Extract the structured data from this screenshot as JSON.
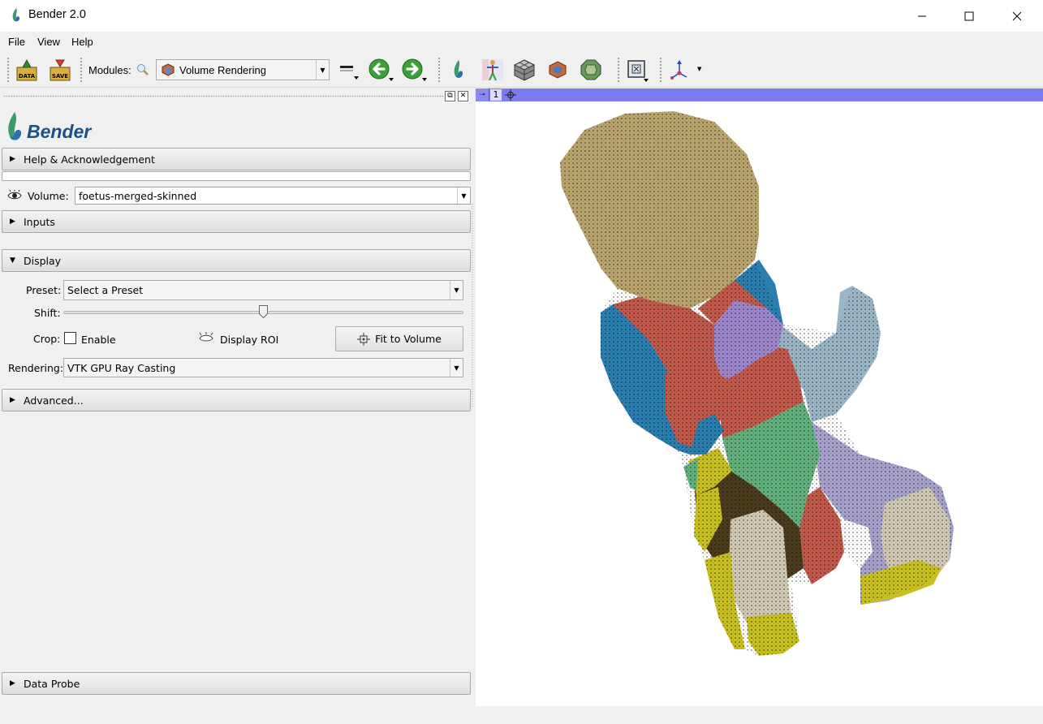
{
  "window": {
    "title": "Bender 2.0",
    "minimize_icon": "minimize-icon",
    "maximize_icon": "maximize-icon",
    "close_icon": "close-icon"
  },
  "menu": [
    "File",
    "View",
    "Help"
  ],
  "toolbar": {
    "load_data_label": "DATA",
    "save_label": "SAVE",
    "modules_label": "Modules:",
    "module_selected": "Volume Rendering",
    "icons": [
      "load-data-icon",
      "save-icon",
      "module-search-icon",
      "module-list-icon",
      "back-arrow-icon",
      "forward-arrow-icon",
      "bender-icon",
      "armature-icon",
      "model-grid-icon",
      "volume-cube-icon",
      "merge-labels-icon",
      "layout-icon",
      "axes-icon"
    ]
  },
  "panel": {
    "logo_text": "Bender",
    "help_section": "Help & Acknowledgement",
    "volume_label": "Volume:",
    "volume_value": "foetus-merged-skinned",
    "inputs_section": "Inputs",
    "display_section": "Display",
    "preset_label": "Preset:",
    "preset_value": "Select a Preset",
    "shift_label": "Shift:",
    "shift_level": 0.5,
    "crop_label": "Crop:",
    "enable_label": "Enable",
    "enable_checked": false,
    "display_roi_label": "Display ROI",
    "fit_button": "Fit to Volume",
    "rendering_label": "Rendering:",
    "rendering_value": "VTK GPU Ray Casting",
    "advanced_section": "Advanced...",
    "data_probe_section": "Data Probe"
  },
  "view": {
    "view_number": "1",
    "background": "#ffffff",
    "bar_color": "#7c7cf0"
  },
  "colors": {
    "head": "#b8a46c",
    "red": "#c25a4c",
    "blue": "#2a7fb0",
    "purple": "#9c86cc",
    "lightblue": "#9ab6c6",
    "green": "#62b07c",
    "lavender": "#a6a2cc",
    "yellow": "#c8c020",
    "dark": "#4a3c1c",
    "ivory": "#cfc9b4"
  }
}
